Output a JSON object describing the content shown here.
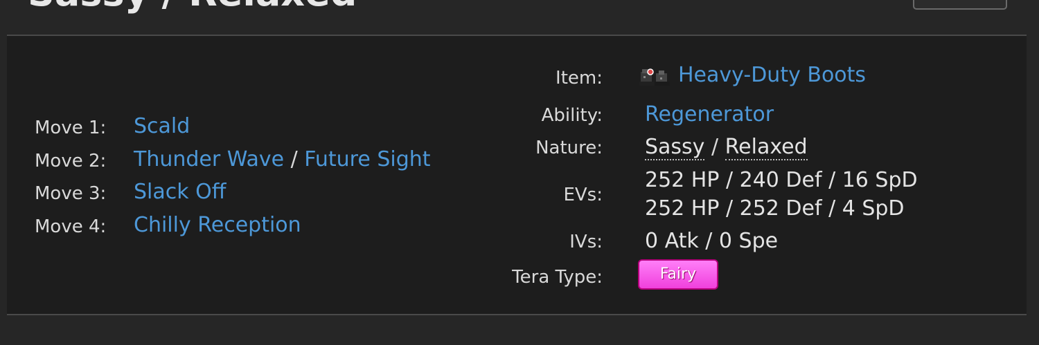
{
  "set": {
    "title": "Sassy / Relaxed"
  },
  "moves": [
    {
      "label": "Move 1:",
      "options": [
        "Scald"
      ]
    },
    {
      "label": "Move 2:",
      "options": [
        "Thunder Wave",
        "Future Sight"
      ]
    },
    {
      "label": "Move 3:",
      "options": [
        "Slack Off"
      ]
    },
    {
      "label": "Move 4:",
      "options": [
        "Chilly Reception"
      ]
    }
  ],
  "move_separator": "/",
  "details": {
    "item_label": "Item:",
    "item_value": "Heavy-Duty Boots",
    "item_icon": "heavy-duty-boots-icon",
    "ability_label": "Ability:",
    "ability_value": "Regenerator",
    "nature_label": "Nature:",
    "nature_values": [
      "Sassy",
      "Relaxed"
    ],
    "evs_label": "EVs:",
    "evs_values": [
      "252 HP / 240 Def / 16 SpD",
      "252 HP / 252 Def / 4 SpD"
    ],
    "ivs_label": "IVs:",
    "ivs_value": "0 Atk / 0 Spe",
    "tera_label": "Tera Type:",
    "tera_value": "Fairy",
    "tera_color": "#f65cf0"
  },
  "colors": {
    "link": "#4d98d8",
    "panel_bg": "#1d1d1d",
    "page_bg": "#262626"
  }
}
